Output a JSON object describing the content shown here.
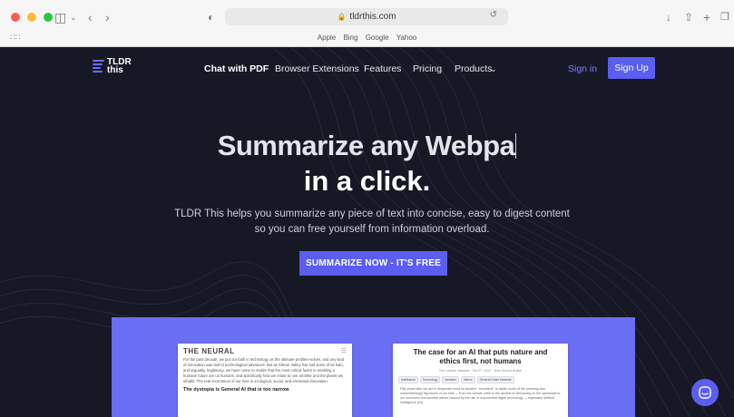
{
  "browser": {
    "url": "tldrthis.com",
    "favorites": [
      "Apple",
      "Bing",
      "Google",
      "Yahoo"
    ]
  },
  "nav": {
    "logo_line1": "TLDR",
    "logo_line2": "this",
    "links": [
      "Chat with PDF",
      "Browser Extensions",
      "Features",
      "Pricing",
      "Products"
    ],
    "sign_in": "Sign in",
    "sign_up": "Sign Up"
  },
  "hero": {
    "line1": "Summarize any Webpa",
    "line2": "in a click.",
    "subtitle": "TLDR This helps you summarize any piece of text into concise, easy to digest content so you can free yourself from information overload.",
    "cta": "SUMMARIZE NOW - IT'S FREE"
  },
  "demo": {
    "left_card": {
      "brand": "THE NEURAL",
      "paragraph": "For the past decade, we put our faith in technology as the ultimate problem-solver, and any kind of innovation was tied to technological advances. But as Silicon Valley has lost some of its halo, and arguably, legitimacy, we have come to realize that the most critical factor in enabling a humane future are us humans, and specifically how we relate to one another and the planet we inhabit. The real reconstruct of our time is ecological, social, and emotional innovation.",
      "heading": "The dystopia is General AI that is too narrow"
    },
    "right_card": {
      "title": "The case for an AI that puts nature and ethics first, not humans",
      "meta": "The Lobster Network · Oct 27, 2022 · View Source Article",
      "tags": [
        "Intellectual",
        "Technology",
        "Idealism",
        "Values",
        "General Urban Machine"
      ],
      "bullet": "Fifty years later we are in desperate need for another \"moonshot\" to tackle some of the pressing and overwhelmingly big issues of our time — from the climate crisis to the decline of democracy to the upheavals to our economic and societal values caused by the rise of exponential digital technology — especially artificial intelligence (AI)."
    }
  },
  "colors": {
    "accent": "#5b5ef0",
    "page_bg": "#171826",
    "demo_bg": "#6a6ef3"
  }
}
